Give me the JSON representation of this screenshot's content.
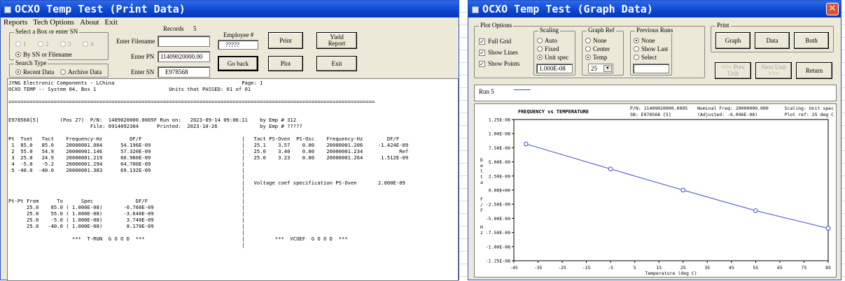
{
  "print_window": {
    "title": "OCXO Temp Test (Print Data)",
    "menu": [
      "Reports",
      "Tech Options",
      "About",
      "Exit"
    ],
    "select_box_group": {
      "label": "Select a Box or enter SN",
      "boxes": [
        "1",
        "2",
        "3",
        "4"
      ],
      "by_sn": "By SN or Filename"
    },
    "search_type_group": {
      "label": "Search Type",
      "recent": "Recent Data",
      "archive": "Archive Data"
    },
    "records_label": "Records",
    "records_value": "5",
    "filename_label": "Enter Filename",
    "filename_value": "",
    "pn_label": "Enter PN",
    "pn_value": "11409020000.00",
    "sn_label": "Enter SN",
    "sn_value": "E978568",
    "employee_label": "Employee #",
    "employee_value": "?????",
    "buttons": {
      "print": "Print",
      "yield_report": "Yield Report",
      "go_back": "Go back",
      "plot": "Plot",
      "exit": "Exit"
    },
    "report_text": "JYNG Electronic Components - LChina                                          Page: 1\nOCXO TEMP -- System 04, Box 1                        Units that PASSED: 01 of 01\n\n=========================================================================================================================\n\n\nE978568[5]       (Pos 27)  P/N:  1409020000.0005F Run on:   2023-09-14 09:06:11    by Emp # 312\n                           File: 0914092304      Printed:  2023-10-26              by Emp # ?????\n\nPt  Tset   Tact    Frequency-Hz         DF/F                                 |   Tact PS-Oven  PS-Osc    Frequency-Hz        DF/F\n 1  85.0   85.0    20000001.084      54.196E-09                              |   25.1    3.57    0.00    20000001.206     -1.424E-09\n 2  55.0   54.9    20000001.146      57.320E-09                              |   25.0    3.40    0.00    20000001.234            Ref\n 3  25.0   24.9    20000001.219      60.960E-09                              |   25.0    3.23    0.00    20000001.264      1.512E-09\n 4  -5.0   -5.2    20000001.294      64.700E-09                              |\n 5 -40.0  -40.0    20000001.383      69.132E-09                              |\n                                                                             |\n                                                                             |   Voltage coef specification PS-Oven       2.000E-09\n                                                                             |\n                                                                             |\nPt-Pt From      To      Spec              DF/F                               |\n      25.0    85.0 ( 1.000E-08)       -6.760E-09                             |\n      25.0    55.0 ( 1.000E-08)       -3.640E-09                             |\n      25.0    -5.0 ( 1.000E-08)        3.740E-09                             |\n      25.0   -40.0 ( 1.000E-08)        8.170E-09                             |\n                                                                             |\n                     ***  T-RUN  G O O D  ***                                |          ***  VCOEF  G O O D  ***\n                                                                             |"
  },
  "graph_window": {
    "title": "OCXO Temp Test (Graph Data)",
    "plot_options": {
      "label": "Plot Options",
      "full_grid": "Full Grid",
      "show_lines": "Show Lines",
      "show_points": "Show Points"
    },
    "scaling": {
      "label": "Scaling",
      "auto": "Auto",
      "fixed": "Fixed",
      "unit_spec": "Unit spec",
      "value": "1.000E-08"
    },
    "graph_ref": {
      "label": "Graph Ref",
      "none": "None",
      "center": "Center",
      "temp": "Temp",
      "dropdown": "25"
    },
    "previous_runs": {
      "label": "Previous Runs",
      "none": "None",
      "show_last": "Show Last",
      "select": "Select"
    },
    "print_group": {
      "label": "Print",
      "graph": "Graph",
      "data": "Data",
      "both": "Both"
    },
    "nav": {
      "prev": "<<< Prev Unit",
      "next": "Next Unit >>>",
      "return": "Return"
    },
    "legend_run": "Run 5",
    "series_color": "#3b4fd4"
  },
  "chart_data": {
    "type": "line",
    "title": "FREQUENCY vs TEMPERATURE",
    "info": {
      "pn": "P/N: 11409020000.0005",
      "sn": "SN: E978568 [5]",
      "nominal": "Nominal Freq:  20000000.000",
      "adjusted": "(Adjusted: -6.096E-08)",
      "scaling": "Scaling:  Unit spec",
      "plot_ref": "Plot ref:  25 deg C"
    },
    "xlabel": "Temperature (deg C)",
    "ylabel": "D e l t a   F / F   H z",
    "xlim": [
      -45,
      85
    ],
    "ylim": [
      -1.25e-08,
      1.25e-08
    ],
    "x_ticks": [
      "-45",
      "-35",
      "-25",
      "-15",
      "-5",
      "5",
      "15",
      "25",
      "35",
      "45",
      "55",
      "65",
      "75",
      "85"
    ],
    "y_ticks": [
      "1.25E-08",
      "1.00E-08",
      "7.50E-09",
      "5.00E-09",
      "2.50E-09",
      "0.00E+00",
      "-2.50E-09",
      "-5.00E-09",
      "-7.50E-09",
      "-1.00E-08",
      "-1.25E-08"
    ],
    "series": [
      {
        "x": [
          -40,
          -5,
          25,
          55,
          85
        ],
        "y": [
          8.17e-09,
          3.74e-09,
          0,
          -3.64e-09,
          -6.76e-09
        ]
      }
    ],
    "grid": false
  }
}
